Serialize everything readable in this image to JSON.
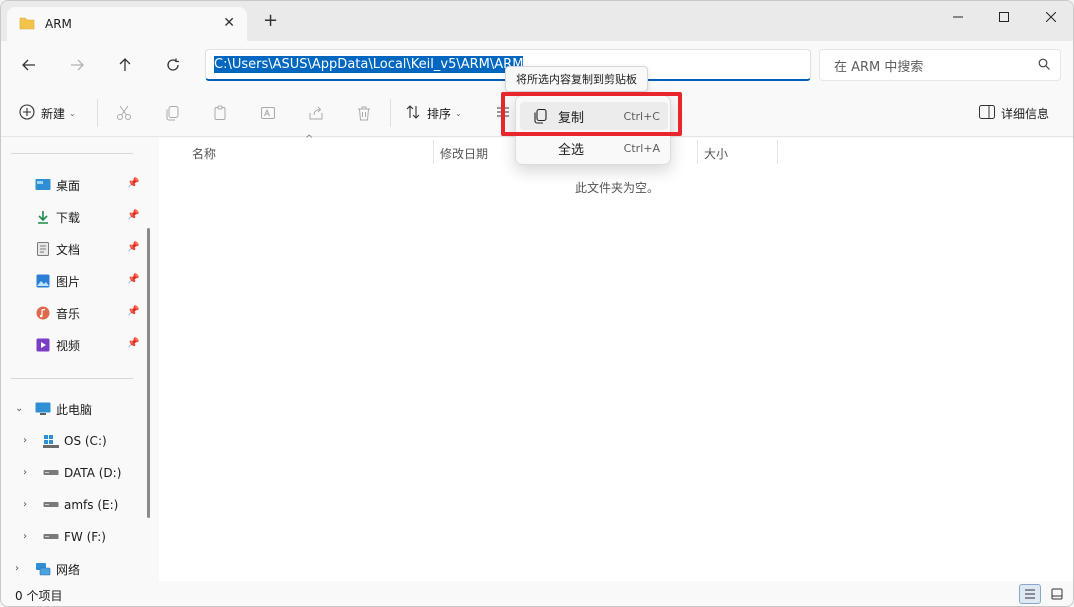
{
  "window": {
    "title": "ARM"
  },
  "tab": {
    "new_tab_glyph": "+",
    "close_glyph": "✕"
  },
  "address": {
    "path": "C:\\Users\\ASUS\\AppData\\Local\\Keil_v5\\ARM\\ARM"
  },
  "search": {
    "placeholder": "在 ARM 中搜索"
  },
  "toolbar": {
    "new_label": "新建",
    "sort_label": "排序",
    "details_label": "详细信息"
  },
  "sidebar": {
    "quick_access": [
      {
        "label": "桌面",
        "icon": "desktop-icon"
      },
      {
        "label": "下载",
        "icon": "download-icon"
      },
      {
        "label": "文档",
        "icon": "document-icon"
      },
      {
        "label": "图片",
        "icon": "pictures-icon"
      },
      {
        "label": "音乐",
        "icon": "music-icon"
      },
      {
        "label": "视频",
        "icon": "videos-icon"
      }
    ],
    "this_pc": "此电脑",
    "drives": [
      {
        "label": "OS (C:)",
        "icon": "windows-drive-icon"
      },
      {
        "label": "DATA (D:)",
        "icon": "drive-icon"
      },
      {
        "label": "amfs (E:)",
        "icon": "drive-icon"
      },
      {
        "label": "FW (F:)",
        "icon": "drive-icon"
      }
    ],
    "network": "网络"
  },
  "columns": {
    "name": "名称",
    "modified": "修改日期",
    "size": "大小"
  },
  "content": {
    "empty_message": "此文件夹为空。"
  },
  "status": {
    "item_count": "0 个项目"
  },
  "tooltip": {
    "text": "将所选内容复制到剪贴板"
  },
  "context_menu": {
    "copy": {
      "label": "复制",
      "shortcut": "Ctrl+C"
    },
    "select_all": {
      "label": "全选",
      "shortcut": "Ctrl+A"
    }
  },
  "colors": {
    "accent": "#0067c0",
    "highlight_box": "#e8262b",
    "folder": "#f2c44c"
  }
}
